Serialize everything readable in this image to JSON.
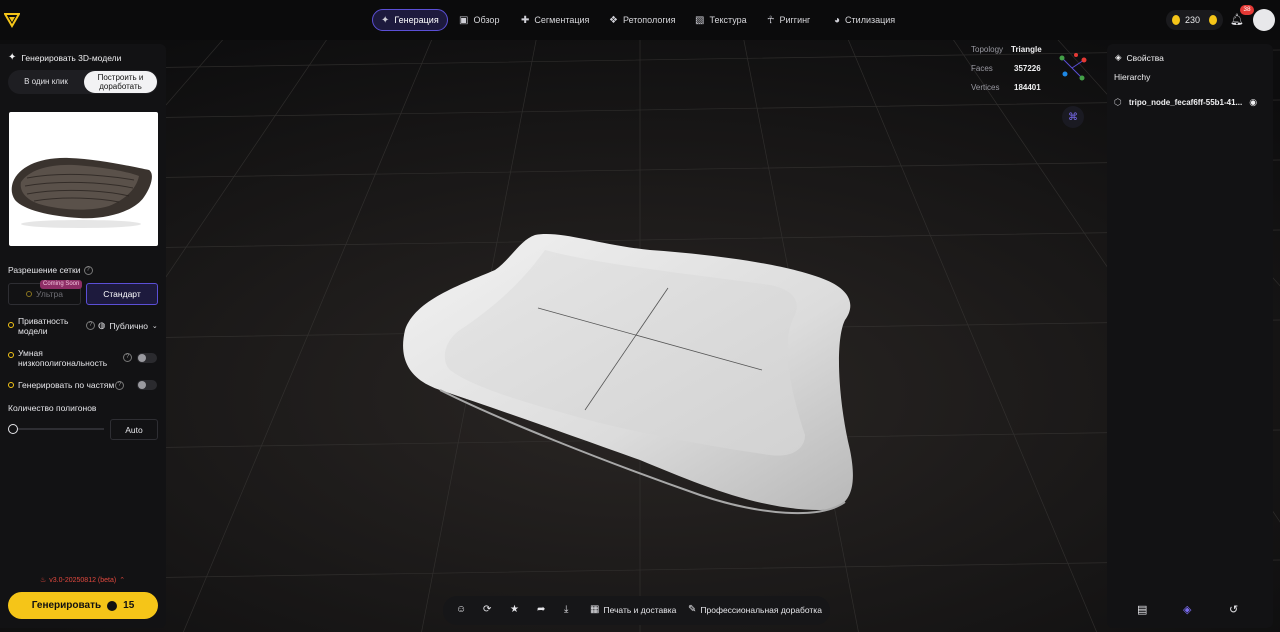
{
  "topnav": {
    "tabs": [
      {
        "label": "Генерация",
        "icon": "sparkle-icon",
        "active": true
      },
      {
        "label": "Обзор",
        "icon": "frame-icon"
      },
      {
        "label": "Сегментация",
        "icon": "puzzle-icon"
      },
      {
        "label": "Ретопология",
        "icon": "mesh-icon"
      },
      {
        "label": "Текстура",
        "icon": "texture-icon"
      },
      {
        "label": "Риггинг",
        "icon": "person-icon"
      },
      {
        "label": "Стилизация",
        "icon": "palette-icon"
      }
    ],
    "credits": "230",
    "notification_count": "38"
  },
  "left_panel": {
    "title": "Генерировать 3D-модели",
    "mode_options": [
      "В один клик",
      "Построить и доработать"
    ],
    "selected_mode": "Построить и доработать",
    "mesh_resolution_label": "Разрешение сетки",
    "resolution_options": [
      {
        "label": "Ультра",
        "badge": "Coming Soon",
        "disabled": true
      },
      {
        "label": "Стандарт",
        "selected": true
      }
    ],
    "privacy_label": "Приватность модели",
    "privacy_value": "Публично",
    "smart_lowpoly_label": "Умная низкополигональность",
    "generate_parts_label": "Генерировать по частям",
    "polycount_label": "Количество полигонов",
    "polycount_value": "Auto",
    "version": "v3.0-20250812 (beta)",
    "generate_button": "Генерировать",
    "generate_cost": "15"
  },
  "viewport": {
    "stats": [
      {
        "key": "Topology",
        "value": "Triangle"
      },
      {
        "key": "Faces",
        "value": "357226"
      },
      {
        "key": "Vertices",
        "value": "184401"
      }
    ]
  },
  "right_panel": {
    "title": "Свойства",
    "hierarchy_label": "Hierarchy",
    "node_name": "tripo_node_fecaf6ff-55b1-41..."
  },
  "bottom_toolbar": {
    "print_label": "Печать и доставка",
    "pro_label": "Профессиональная доработка"
  },
  "colors": {
    "accent": "#f5c518",
    "active_tab_border": "#5b4fd6",
    "panel_bg": "#121214"
  }
}
